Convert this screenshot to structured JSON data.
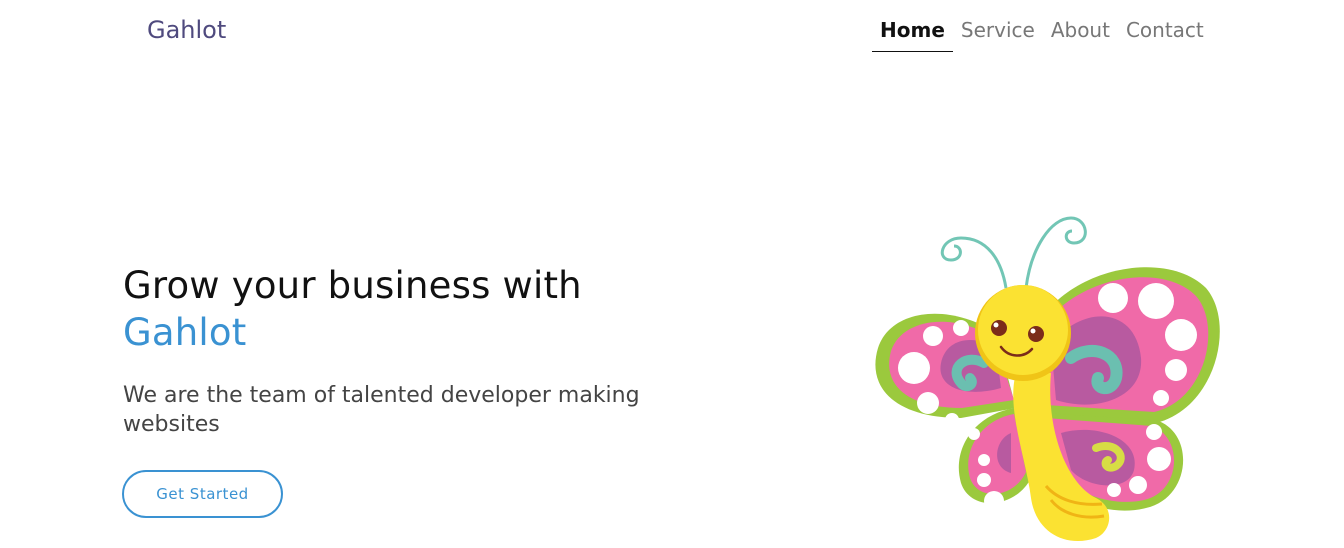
{
  "nav": {
    "brand": "Gahlot",
    "links": [
      "Home",
      "Service",
      "About",
      "Contact"
    ],
    "active_index": 0
  },
  "hero": {
    "title_line1": "Grow your business with",
    "title_brand": "Gahlot",
    "subtitle": "We are the team of talented developer making websites",
    "cta_label": "Get Started"
  },
  "illustration": {
    "icon": "butterfly-illustration",
    "colors": {
      "wing": "#f06aa8",
      "wing_edge": "#9bc93d",
      "inner_wing": "#b85aa0",
      "swirl": "#6bbfb0",
      "body": "#fbe232"
    }
  },
  "colors": {
    "brand": "#4f4a7e",
    "accent": "#3a92d2",
    "text": "#111111"
  }
}
